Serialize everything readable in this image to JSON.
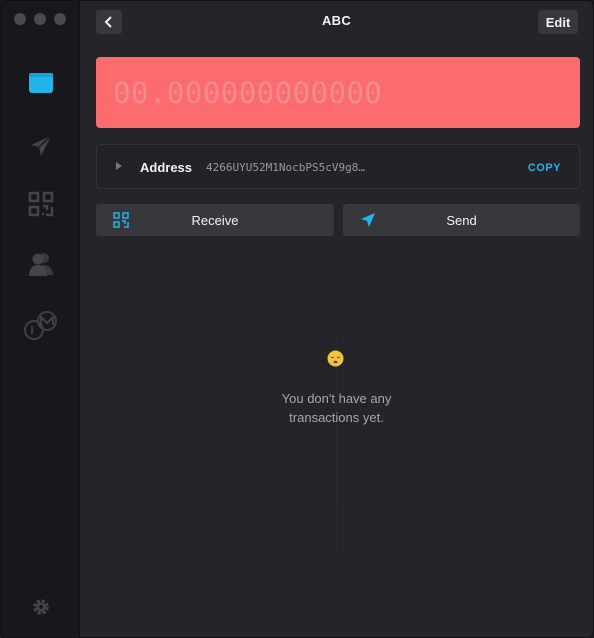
{
  "window": {
    "title": "ABC"
  },
  "header": {
    "back_label": "<",
    "edit_label": "Edit"
  },
  "sidebar": {
    "items": [
      {
        "icon": "wallet-icon",
        "active": true
      },
      {
        "icon": "send-plane-icon",
        "active": false
      },
      {
        "icon": "qr-code-icon",
        "active": false
      },
      {
        "icon": "contacts-icon",
        "active": false
      },
      {
        "icon": "monero-coins-icon",
        "active": false
      }
    ],
    "footer_icon": "gear-icon"
  },
  "balance": {
    "amount": "00.000000000000",
    "color": "#fc6b6d"
  },
  "address": {
    "label": "Address",
    "value": "4266UYU52M1NocbPS5cV9g8…",
    "copy_label": "COPY"
  },
  "actions": {
    "receive_label": "Receive",
    "send_label": "Send"
  },
  "empty_state": {
    "emoji": "sleeping-face-emoji",
    "line1": "You don't have any",
    "line2": "transactions yet."
  },
  "colors": {
    "accent": "#1fb4ec",
    "balance_bg": "#fc6b6d",
    "sidebar_bg": "#18171b",
    "main_bg": "#252428"
  }
}
